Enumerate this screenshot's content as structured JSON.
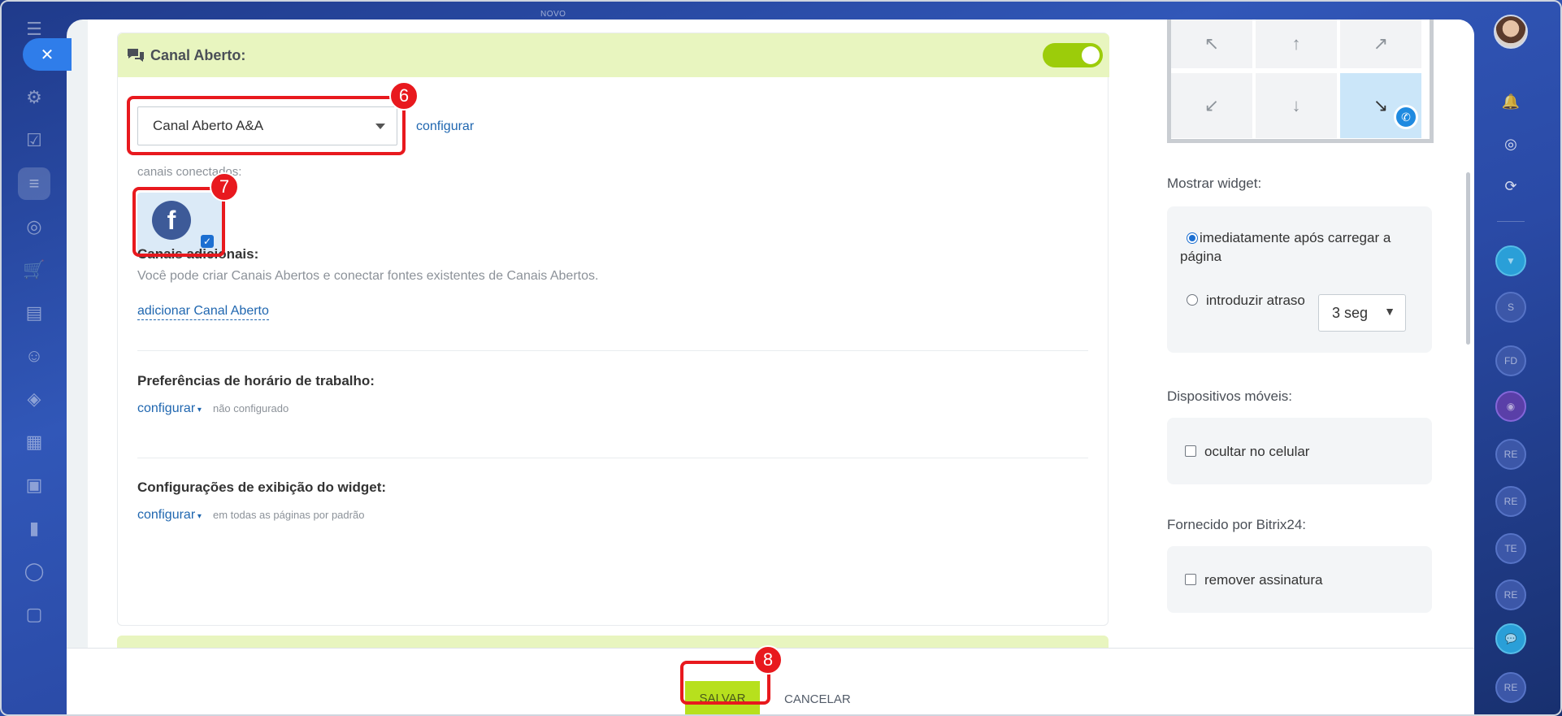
{
  "top_hint": "NOVO",
  "section": {
    "title": "Canal Aberto:",
    "toggle_on": true,
    "channel_select": "Canal Aberto A&A",
    "configure_link": "configurar",
    "connected_label": "canais conectados:",
    "connected_channels": [
      {
        "name": "Facebook",
        "icon": "facebook-icon",
        "checked": true
      }
    ],
    "additional_title": "Canais adicionais:",
    "additional_desc": "Você pode criar Canais Abertos e conectar fontes existentes de Canais Abertos.",
    "add_link": "adicionar Canal Aberto",
    "work_hours_title": "Preferências de horário de trabalho:",
    "work_hours_link": "configurar",
    "work_hours_status": "não configurado",
    "display_title": "Configurações de exibição do widget:",
    "display_link": "configurar",
    "display_status": "em todas as páginas por padrão"
  },
  "annotations": {
    "six": "6",
    "seven": "7",
    "eight": "8"
  },
  "right_panel": {
    "show_widget_label": "Mostrar widget:",
    "immediate_option": "imediatamente após carregar a página",
    "immediate_selected": true,
    "delay_option": "introduzir atraso",
    "delay_value": "3 seg",
    "mobile_label": "Dispositivos móveis:",
    "hide_mobile": "ocultar no celular",
    "powered_label": "Fornecido por Bitrix24:",
    "remove_signature": "remover assinatura"
  },
  "footer": {
    "save": "SALVAR",
    "cancel": "CANCELAR"
  },
  "right_sidebar": {
    "bubbles": [
      "S",
      "FD",
      "RE",
      "RE",
      "TE",
      "RE",
      "RE"
    ]
  },
  "colors": {
    "accent_green": "#b7e01d",
    "header_green": "#e8f5bf",
    "highlight_red": "#e8191e",
    "link_blue": "#2067b0"
  }
}
